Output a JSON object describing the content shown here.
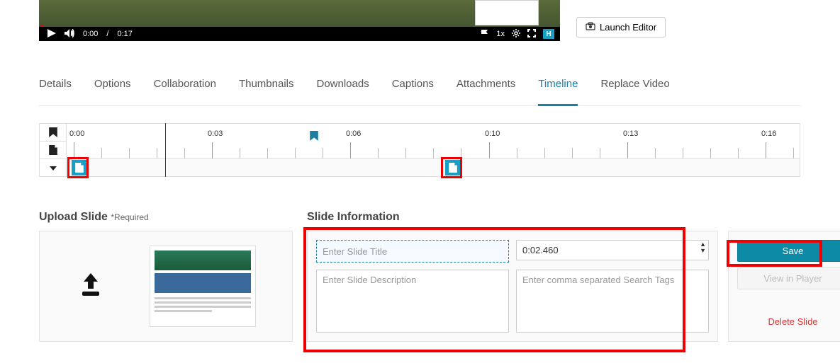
{
  "video": {
    "currentTime": "0:00",
    "duration": "0:17",
    "speed": "1x"
  },
  "buttons": {
    "launchEditor": "Launch Editor"
  },
  "tabs": [
    {
      "label": "Details"
    },
    {
      "label": "Options"
    },
    {
      "label": "Collaboration"
    },
    {
      "label": "Thumbnails"
    },
    {
      "label": "Downloads"
    },
    {
      "label": "Captions"
    },
    {
      "label": "Attachments"
    },
    {
      "label": "Timeline",
      "active": true
    },
    {
      "label": "Replace Video"
    }
  ],
  "timeline": {
    "labels": [
      "0:00",
      "0:03",
      "0:06",
      "0:10",
      "0:13",
      "0:16"
    ]
  },
  "sections": {
    "uploadSlide": "Upload Slide",
    "required": "*Required",
    "slideInfo": "Slide Information"
  },
  "slideForm": {
    "titlePlaceholder": "Enter Slide Title",
    "timeValue": "0:02.460",
    "descPlaceholder": "Enter Slide Description",
    "tagsPlaceholder": "Enter comma separated Search Tags"
  },
  "actions": {
    "save": "Save",
    "viewInPlayer": "View in Player",
    "deleteSlide": "Delete Slide"
  }
}
